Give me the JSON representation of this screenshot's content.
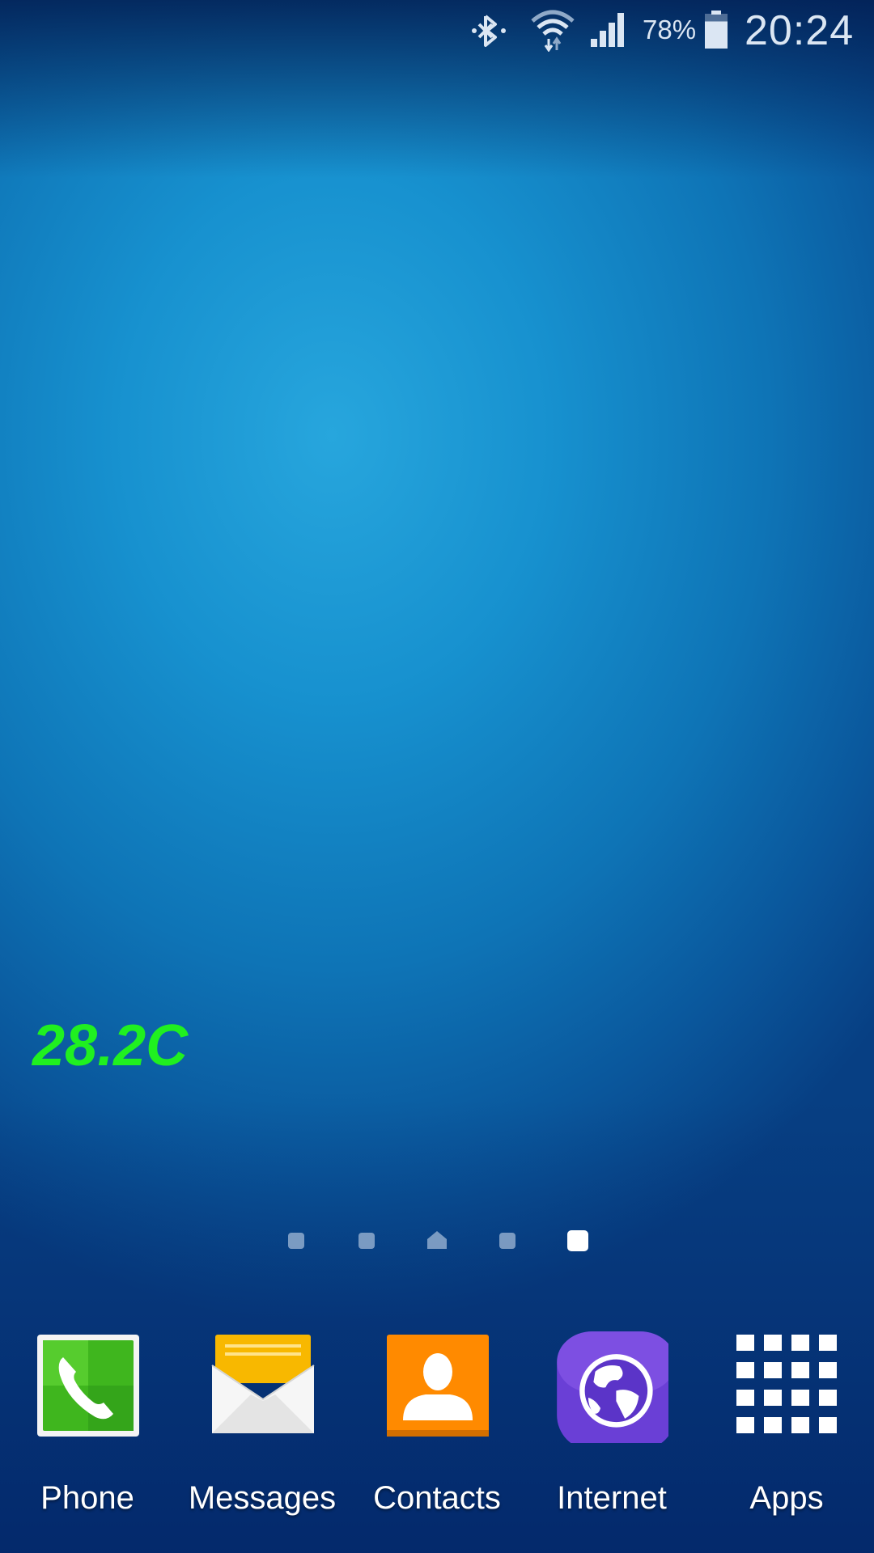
{
  "status_bar": {
    "battery_percent": "78%",
    "battery_level": 0.78,
    "time": "20:24",
    "icons": [
      "bluetooth-icon",
      "wifi-icon",
      "signal-icon",
      "battery-icon"
    ]
  },
  "widget": {
    "temperature": "28.2C",
    "color": "#20f020"
  },
  "page_indicator": {
    "total_pages": 5,
    "home_page_index": 2,
    "active_page_index": 4
  },
  "dock": {
    "apps": [
      {
        "label": "Phone",
        "icon": "phone-icon"
      },
      {
        "label": "Messages",
        "icon": "messages-icon"
      },
      {
        "label": "Contacts",
        "icon": "contacts-icon"
      },
      {
        "label": "Internet",
        "icon": "internet-icon"
      },
      {
        "label": "Apps",
        "icon": "apps-grid-icon"
      }
    ]
  }
}
